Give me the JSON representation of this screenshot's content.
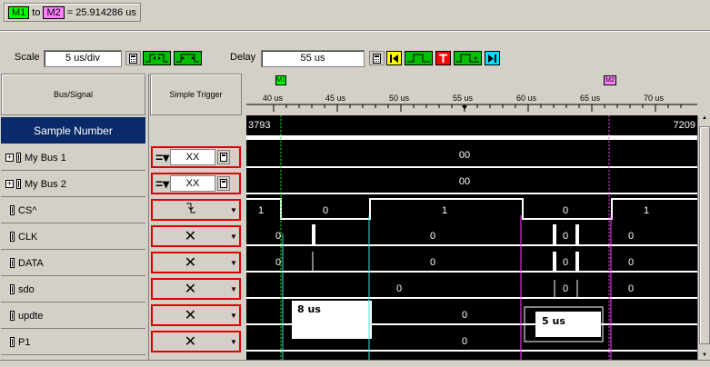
{
  "marker_readout": {
    "m1": "M1",
    "to": "to",
    "m2": "M2",
    "value": "= 25.914286 us"
  },
  "controls": {
    "scale_label": "Scale",
    "scale_value": "5 us/div",
    "delay_label": "Delay",
    "delay_value": "55 us"
  },
  "columns": {
    "bus_signal": "Bus/Signal",
    "simple_trigger": "Simple Trigger"
  },
  "ruler": {
    "ticks": [
      "40 us",
      "45 us",
      "50 us",
      "55 us",
      "60 us",
      "65 us",
      "70 us"
    ],
    "marker1": "M1",
    "marker2": "M2"
  },
  "sample_number": {
    "label": "Sample Number",
    "left": "3793",
    "right": "7209"
  },
  "signals": [
    {
      "name": "My Bus 1",
      "type": "bus",
      "trigger": "XX",
      "value": "00"
    },
    {
      "name": "My Bus 2",
      "type": "bus",
      "trigger": "XX",
      "value": "00"
    },
    {
      "name": "CS^",
      "type": "sig",
      "trigger": "falling-edge",
      "values": [
        "1",
        "0",
        "1",
        "0",
        "1"
      ]
    },
    {
      "name": "CLK",
      "type": "sig",
      "trigger": "X",
      "values": [
        "0",
        "0",
        "0",
        "0"
      ]
    },
    {
      "name": "DATA",
      "type": "sig",
      "trigger": "X",
      "values": [
        "0",
        "0",
        "0",
        "0"
      ]
    },
    {
      "name": "sdo",
      "type": "sig",
      "trigger": "X",
      "values": [
        "0",
        "0",
        "0"
      ]
    },
    {
      "name": "updte",
      "type": "sig",
      "trigger": "X",
      "values": [
        "0"
      ]
    },
    {
      "name": "P1",
      "type": "sig",
      "trigger": "X",
      "values": [
        "0"
      ]
    }
  ],
  "annotations": {
    "a1": "8 us",
    "a2": "5 us"
  },
  "colors": {
    "m1": "#00ff00",
    "m2": "#ff80ff",
    "trace": "#ffffff",
    "trigger_border": "#e00000",
    "sample_bg": "#0a2a6a",
    "cursor_cyan": "#40e0e0",
    "cursor_magenta": "#ff40ff"
  }
}
